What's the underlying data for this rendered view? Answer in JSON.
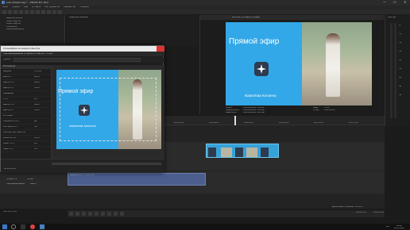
{
  "window": {
    "title": "Live stream.veg * - VEGAS Pro 16.0",
    "min": "—",
    "max": "☐",
    "close": "✕"
  },
  "menu": [
    "Файл",
    "Правка",
    "Вид",
    "Вставка",
    "Инструменты",
    "Параметры",
    "Справка"
  ],
  "explorer": {
    "path": "Видеоматериалы",
    "tree": [
      "NewBlue Effects",
      "Audio Plug-Ins",
      "Video Plug-Ins",
      "Transitions",
      "Media Generators"
    ]
  },
  "dialog": {
    "title": "Спецэффекты видеособытия",
    "tabs": "Панорамирование и обрезка событий - 1.mov",
    "preset_label": "Пресет:",
    "panel_position": "Положение",
    "rows": [
      {
        "label": "Ширина",
        "value": "1 076,0"
      },
      {
        "label": "Высота",
        "value": "605,3"
      },
      {
        "label": "Центр по X",
        "value": "960,0"
      },
      {
        "label": "Центр по Y",
        "value": "540,0"
      },
      {
        "label": "Вращение",
        "value": ""
      },
      {
        "label": "Угол",
        "value": "0,0"
      },
      {
        "label": "Центр по X",
        "value": "960,0"
      },
      {
        "label": "Центр по Y",
        "value": "540,0"
      },
      {
        "label": "Источник",
        "value": ""
      },
      {
        "label": "Сохранять соо...",
        "value": "Да"
      },
      {
        "label": "Растянуть по...",
        "value": "Нет"
      },
      {
        "label": "Рабочее пространство",
        "value": ""
      },
      {
        "label": "Масштаб (%)",
        "value": "100,0"
      },
      {
        "label": "Сдвиг по X",
        "value": "0,0"
      },
      {
        "label": "Сдвиг по Y",
        "value": "0,0"
      }
    ],
    "preview_title": "Прямой эфир",
    "preview_name": "Nadezhda Koroleva",
    "timecode": "00:00:00;00"
  },
  "preview": {
    "title": "Прямой эфир",
    "name": "Nadezhda Koroleva",
    "label": "Монтаж (полный (Полный)",
    "info_left": [
      "Проект:",
      "Предпросмотр:",
      "Видео-окно:"
    ],
    "info_mid": [
      "1920x1080x32, 29,970i",
      "1920x1080x32, 29,970p",
      "1920x1080x32, 29,970p"
    ],
    "info_right": [
      "Кадр:",
      "Отобр.:"
    ],
    "info_right_val": [
      "1 148",
      "636x358x32"
    ]
  },
  "vu": {
    "label": "Мастер",
    "scale": [
      "-6",
      "-12",
      "-18",
      "-24",
      "-30",
      "-36",
      "-42",
      "-48",
      "-54"
    ]
  },
  "timeline": {
    "timecode": "00:00:38;10",
    "ruler": [
      "00:00:00;00",
      "00:00:10;00",
      "00:00:20;00",
      "00:00:30;00",
      "00:00:40;00",
      "00:00:49;29",
      "00:00:59;28",
      "00:01:09;29",
      "00:01:19;29"
    ],
    "track1": {
      "label": "Уровень",
      "value": "100,0 %"
    },
    "track2": {
      "label": "Громкость",
      "value": "0,0 дБ",
      "pan_label": "Панорамирование",
      "pan_value": "Центр"
    },
    "audio_clip": "Noisy 2011 PY ... 11 05 25 М",
    "rate": "Частота: 0,00",
    "status_right": "Время записи (2 каналов): 120:02:15",
    "status_tc": "00:00:38;10",
    "status_tc2": "00:01:12;46"
  },
  "taskbar": {
    "time": "14:25",
    "date": "22.07.2019",
    "lang": "РУС"
  }
}
